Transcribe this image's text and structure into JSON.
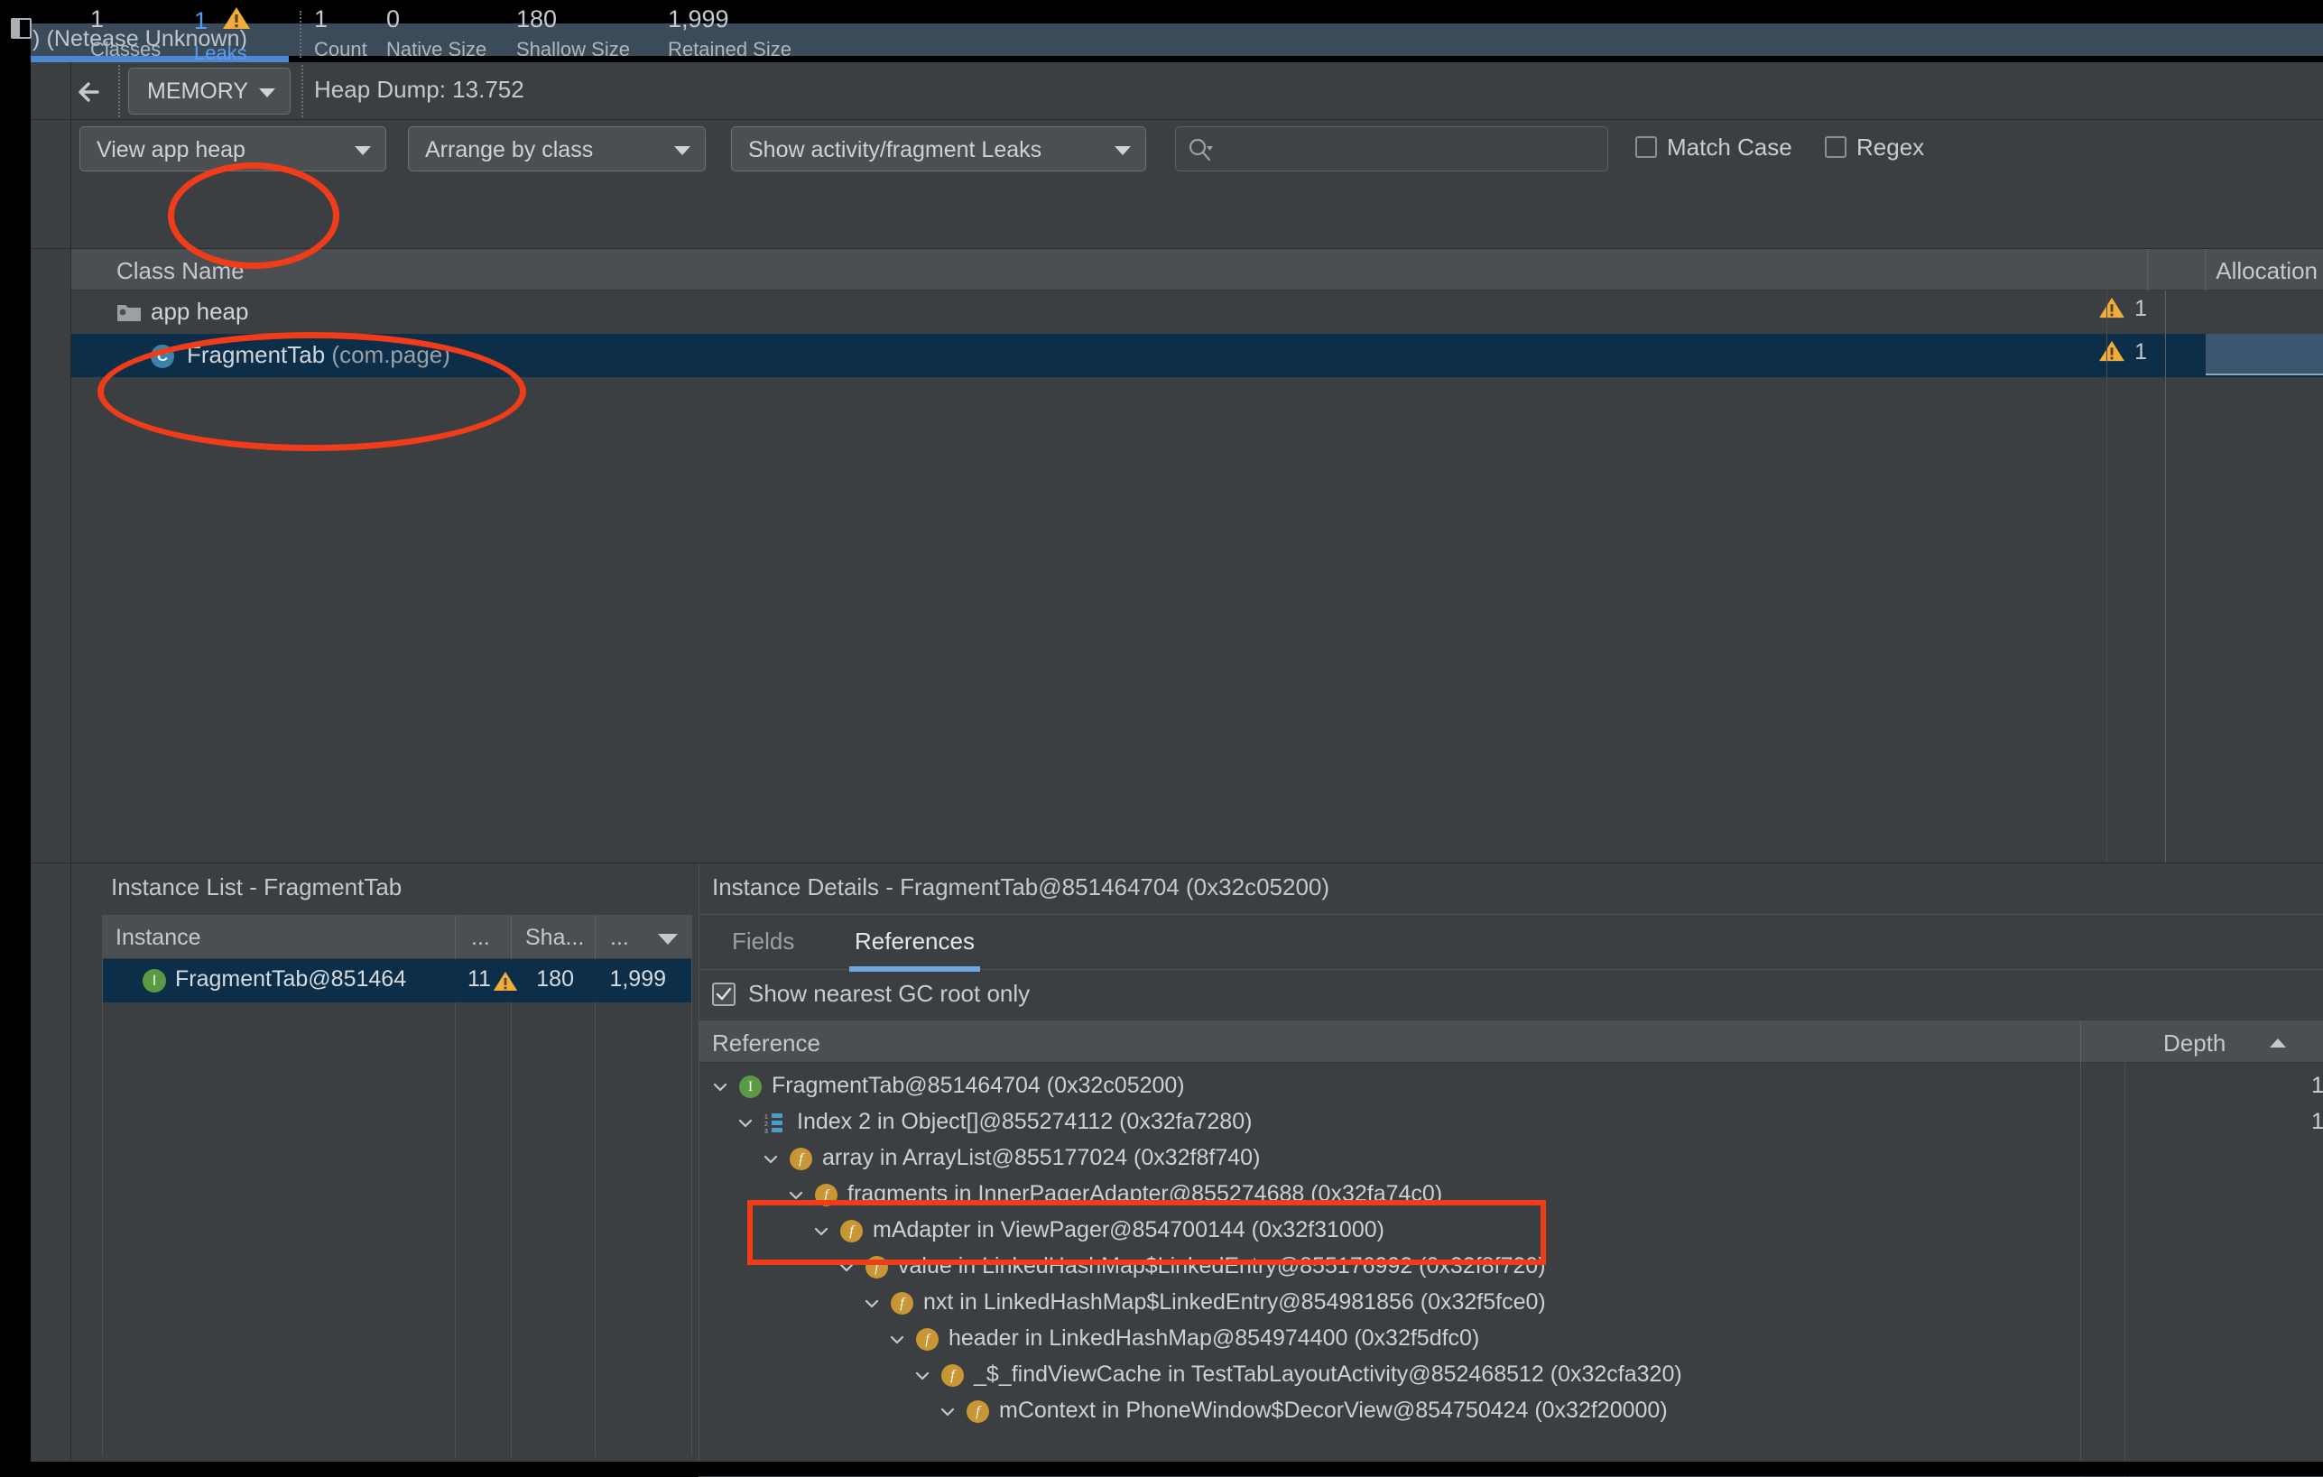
{
  "window": {
    "tab_title": ") (Netease Unknown)"
  },
  "toolbar": {
    "panel_toggle_icon": "panel-toggle-icon",
    "back_icon": "back-arrow-icon",
    "profiler_mode": "MEMORY",
    "heap_dump_label": "Heap Dump: 13.752"
  },
  "filters": {
    "heap_select": "View app heap",
    "arrange_select": "Arrange by class",
    "leaks_select": "Show activity/fragment Leaks",
    "search_placeholder": "",
    "search_value": "",
    "search_icon": "search-icon",
    "match_case_label": "Match Case",
    "match_case_checked": false,
    "regex_label": "Regex",
    "regex_checked": false
  },
  "stats": [
    {
      "value": "1",
      "caption": "Classes",
      "warn": false,
      "highlight": false
    },
    {
      "value": "1",
      "caption": "Leaks",
      "warn": true,
      "highlight": true
    },
    {
      "value": "1",
      "caption": "Count",
      "warn": false,
      "highlight": false
    },
    {
      "value": "0",
      "caption": "Native Size",
      "warn": false,
      "highlight": false
    },
    {
      "value": "180",
      "caption": "Shallow Size",
      "warn": false,
      "highlight": false
    },
    {
      "value": "1,999",
      "caption": "Retained Size",
      "warn": false,
      "highlight": false
    }
  ],
  "class_table": {
    "col_class_name": "Class Name",
    "col_allocations": "Allocation",
    "rows": [
      {
        "label": "app heap",
        "package": "",
        "icon": "heap-folder-icon",
        "warn_count": "1",
        "selected": false
      },
      {
        "label": "FragmentTab",
        "package": "(com.page)",
        "icon": "class-icon",
        "warn_count": "1",
        "selected": true
      }
    ]
  },
  "instance_list": {
    "title": "Instance List - FragmentTab",
    "columns": [
      "Instance",
      "...",
      "Sha...",
      "..."
    ],
    "rows": [
      {
        "name": "FragmentTab@851464",
        "depth": "11",
        "shallow": "180",
        "retained": "1,999",
        "selected": true
      }
    ]
  },
  "instance_details": {
    "title": "Instance Details - FragmentTab@851464704 (0x32c05200)",
    "tabs": [
      {
        "label": "Fields",
        "active": false
      },
      {
        "label": "References",
        "active": true
      }
    ],
    "gc_root_label": "Show nearest GC root only",
    "gc_root_checked": true,
    "col_reference": "Reference",
    "col_depth": "Depth",
    "references": [
      {
        "text": "FragmentTab@851464704 (0x32c05200)",
        "indent": 0,
        "icon": "instance-icon",
        "depth": "1"
      },
      {
        "text": "Index 2 in Object[]@855274112 (0x32fa7280)",
        "indent": 1,
        "icon": "array-icon",
        "depth": "1"
      },
      {
        "text": "array in ArrayList@855177024 (0x32f8f740)",
        "indent": 2,
        "icon": "field-icon",
        "depth": ""
      },
      {
        "text": "fragments in InnerPagerAdapter@855274688 (0x32fa74c0)",
        "indent": 3,
        "icon": "field-icon",
        "depth": ""
      },
      {
        "text": "mAdapter in ViewPager@854700144 (0x32f31000)",
        "indent": 4,
        "icon": "field-icon",
        "depth": ""
      },
      {
        "text": "value in LinkedHashMap$LinkedEntry@855176992 (0x32f8f720)",
        "indent": 5,
        "icon": "field-icon",
        "depth": ""
      },
      {
        "text": "nxt in LinkedHashMap$LinkedEntry@854981856 (0x32f5fce0)",
        "indent": 6,
        "icon": "field-icon",
        "depth": ""
      },
      {
        "text": "header in LinkedHashMap@854974400 (0x32f5dfc0)",
        "indent": 7,
        "icon": "field-icon",
        "depth": ""
      },
      {
        "text": "_$_findViewCache in TestTabLayoutActivity@852468512 (0x32cfa320)",
        "indent": 8,
        "icon": "field-icon",
        "depth": ""
      },
      {
        "text": "mContext in PhoneWindow$DecorView@854750424 (0x32f20000)",
        "indent": 9,
        "icon": "field-icon",
        "depth": ""
      }
    ]
  },
  "annotations": {
    "color": "#f03c18",
    "shapes": [
      {
        "kind": "ellipse",
        "name": "leaks-highlight"
      },
      {
        "kind": "ellipse",
        "name": "fragmenttab-class-highlight"
      },
      {
        "kind": "rect",
        "name": "innerpageradapter-reference-highlight"
      }
    ]
  }
}
